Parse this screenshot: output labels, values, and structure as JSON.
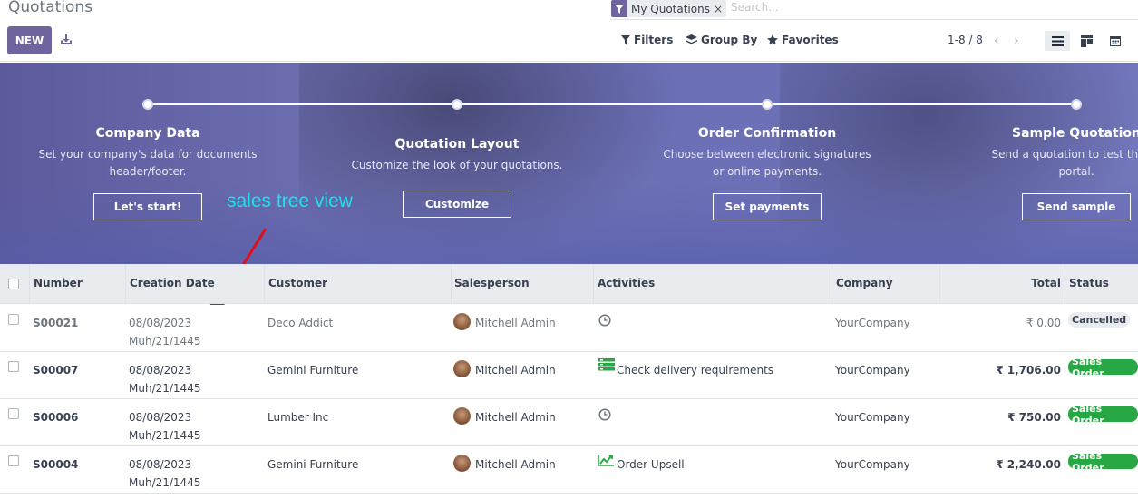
{
  "header": {
    "title": "Quotations",
    "new_label": "NEW",
    "search_facet": "My Quotations",
    "search_facet_close": "×",
    "search_placeholder": "Search...",
    "filters_label": "Filters",
    "groupby_label": "Group By",
    "favorites_label": "Favorites",
    "pager": "1-8 / 8",
    "pager_prev": "‹",
    "pager_next": "›"
  },
  "banner": {
    "steps": [
      {
        "title": "Company Data",
        "desc1": "Set your company's data for documents",
        "desc2": "header/footer.",
        "button": "Let's start!"
      },
      {
        "title": "Quotation Layout",
        "desc1": "Customize the look of your quotations.",
        "desc2": "",
        "button": "Customize"
      },
      {
        "title": "Order Confirmation",
        "desc1": "Choose between electronic signatures",
        "desc2": "or online payments.",
        "button": "Set payments"
      },
      {
        "title": "Sample Quotation",
        "desc1": "Send a quotation to test the cu",
        "desc2": "portal.",
        "button": "Send sample"
      }
    ],
    "annotation": "sales tree view"
  },
  "table": {
    "columns": [
      "Number",
      "Creation Date",
      "Customer",
      "Salesperson",
      "Activities",
      "Company",
      "Total",
      "Status"
    ],
    "rows": [
      {
        "number": "S00021",
        "date": "08/08/2023",
        "hijri": "Muh/21/1445",
        "customer": "Deco Addict",
        "salesperson": "Mitchell Admin",
        "activity": "",
        "activity_icon": "clock-icon",
        "company": "YourCompany",
        "total": "₹ 0.00",
        "status": "Cancelled",
        "muted": true
      },
      {
        "number": "S00007",
        "date": "08/08/2023",
        "hijri": "Muh/21/1445",
        "customer": "Gemini Furniture",
        "salesperson": "Mitchell Admin",
        "activity": "Check delivery requirements",
        "activity_icon": "list-icon",
        "company": "YourCompany",
        "total": "₹ 1,706.00",
        "status": "Sales Order",
        "muted": false
      },
      {
        "number": "S00006",
        "date": "08/08/2023",
        "hijri": "Muh/21/1445",
        "customer": "Lumber Inc",
        "salesperson": "Mitchell Admin",
        "activity": "",
        "activity_icon": "clock-icon",
        "company": "YourCompany",
        "total": "₹ 750.00",
        "status": "Sales Order",
        "muted": false
      },
      {
        "number": "S00004",
        "date": "08/08/2023",
        "hijri": "Muh/21/1445",
        "customer": "Gemini Furniture",
        "salesperson": "Mitchell Admin",
        "activity": "Order Upsell",
        "activity_icon": "trend-up-icon",
        "company": "YourCompany",
        "total": "₹ 2,240.00",
        "status": "Sales Order",
        "muted": false
      }
    ]
  },
  "colors": {
    "brand": "#71639e",
    "success": "#28a745",
    "annotation": "#1fe0ef",
    "arrow": "#e0101a"
  }
}
